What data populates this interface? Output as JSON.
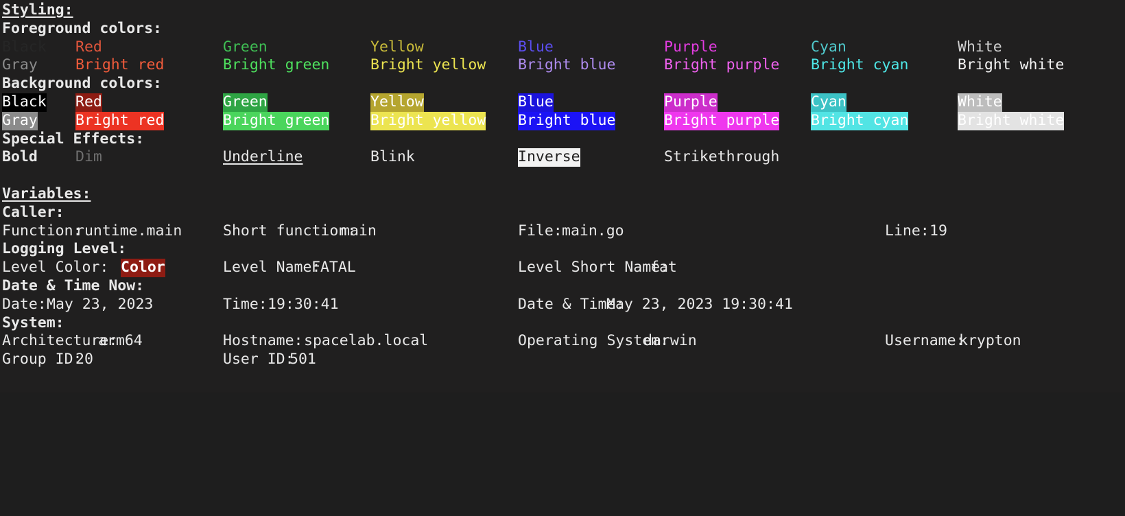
{
  "terminal": {
    "background_color": "#201f1f",
    "default_text_color": "#e8e8e8"
  },
  "styling": {
    "heading": "Styling:",
    "foreground_label": "Foreground colors:",
    "background_label": "Background colors:",
    "effects_label": "Special Effects:",
    "foreground_colors": [
      {
        "normal": "Black",
        "bright": "Gray",
        "normal_hex": "#262626",
        "bright_hex": "#8b8b8b"
      },
      {
        "normal": "Red",
        "bright": "Bright red",
        "normal_hex": "#e2563c",
        "bright_hex": "#f05b3b"
      },
      {
        "normal": "Green",
        "bright": "Bright green",
        "normal_hex": "#3fbf54",
        "bright_hex": "#4ee05e"
      },
      {
        "normal": "Yellow",
        "bright": "Bright yellow",
        "normal_hex": "#c9bb3a",
        "bright_hex": "#ece450"
      },
      {
        "normal": "Blue",
        "bright": "Bright blue",
        "normal_hex": "#5b4ef0",
        "bright_hex": "#ae8bee"
      },
      {
        "normal": "Purple",
        "bright": "Bright purple",
        "normal_hex": "#e23ce0",
        "bright_hex": "#ef61ee"
      },
      {
        "normal": "Cyan",
        "bright": "Bright cyan",
        "normal_hex": "#50c9cc",
        "bright_hex": "#4ee8e8"
      },
      {
        "normal": "White",
        "bright": "Bright white",
        "normal_hex": "#cfcfcf",
        "bright_hex": "#f4f4f4"
      }
    ],
    "background_colors": [
      {
        "normal": "Black",
        "bright": "Gray",
        "normal_hex": "#000000",
        "bright_hex": "#8b8b8b"
      },
      {
        "normal": "Red",
        "bright": "Bright red",
        "normal_hex": "#8e1c13",
        "bright_hex": "#ec3323"
      },
      {
        "normal": "Green",
        "bright": "Bright green",
        "normal_hex": "#2fa544",
        "bright_hex": "#4ad55c"
      },
      {
        "normal": "Yellow",
        "bright": "Bright yellow",
        "normal_hex": "#b5a52f",
        "bright_hex": "#ece450"
      },
      {
        "normal": "Blue",
        "bright": "Bright blue",
        "normal_hex": "#1b13dd",
        "bright_hex": "#1b13f5"
      },
      {
        "normal": "Purple",
        "bright": "Bright purple",
        "normal_hex": "#cc2ecb",
        "bright_hex": "#ef37ee"
      },
      {
        "normal": "Cyan",
        "bright": "Bright cyan",
        "normal_hex": "#3cc2c5",
        "bright_hex": "#52e4e4"
      },
      {
        "normal": "White",
        "bright": "Bright white",
        "normal_hex": "#bdbdbd",
        "bright_hex": "#e3e3e3"
      }
    ],
    "effects": {
      "bold": "Bold",
      "dim": "Dim",
      "underline": "Underline",
      "blink": "Blink",
      "inverse": "Inverse",
      "strikethrough": "Strikethrough"
    }
  },
  "variables": {
    "heading": "Variables:",
    "caller": {
      "label": "Caller:",
      "function_label": "Function:",
      "function_value": "runtime.main",
      "short_function_label": "Short function:",
      "short_function_value": "main",
      "file_label": "File:",
      "file_value": "main.go",
      "line_label": "Line:",
      "line_value": "19"
    },
    "logging_level": {
      "label": "Logging Level:",
      "level_color_label": "Level Color:",
      "level_color_value": "Color",
      "level_color_hex": "#8e1c13",
      "level_name_label": "Level Name:",
      "level_name_value": "FATAL",
      "level_short_name_label": "Level Short Name:",
      "level_short_name_value": "fat"
    },
    "date_time": {
      "label": "Date & Time Now:",
      "date_label": "Date:",
      "date_value": "May 23, 2023",
      "time_label": "Time:",
      "time_value": "19:30:41",
      "datetime_label": "Date & Time:",
      "datetime_value": "May 23, 2023 19:30:41"
    },
    "system": {
      "label": "System:",
      "architecture_label": "Architecture:",
      "architecture_value": "arm64",
      "hostname_label": "Hostname:",
      "hostname_value": "spacelab.local",
      "os_label": "Operating System:",
      "os_value": "darwin",
      "username_label": "Username:",
      "username_value": "krypton",
      "group_id_label": "Group ID:",
      "group_id_value": "20",
      "user_id_label": "User ID:",
      "user_id_value": "501"
    }
  }
}
